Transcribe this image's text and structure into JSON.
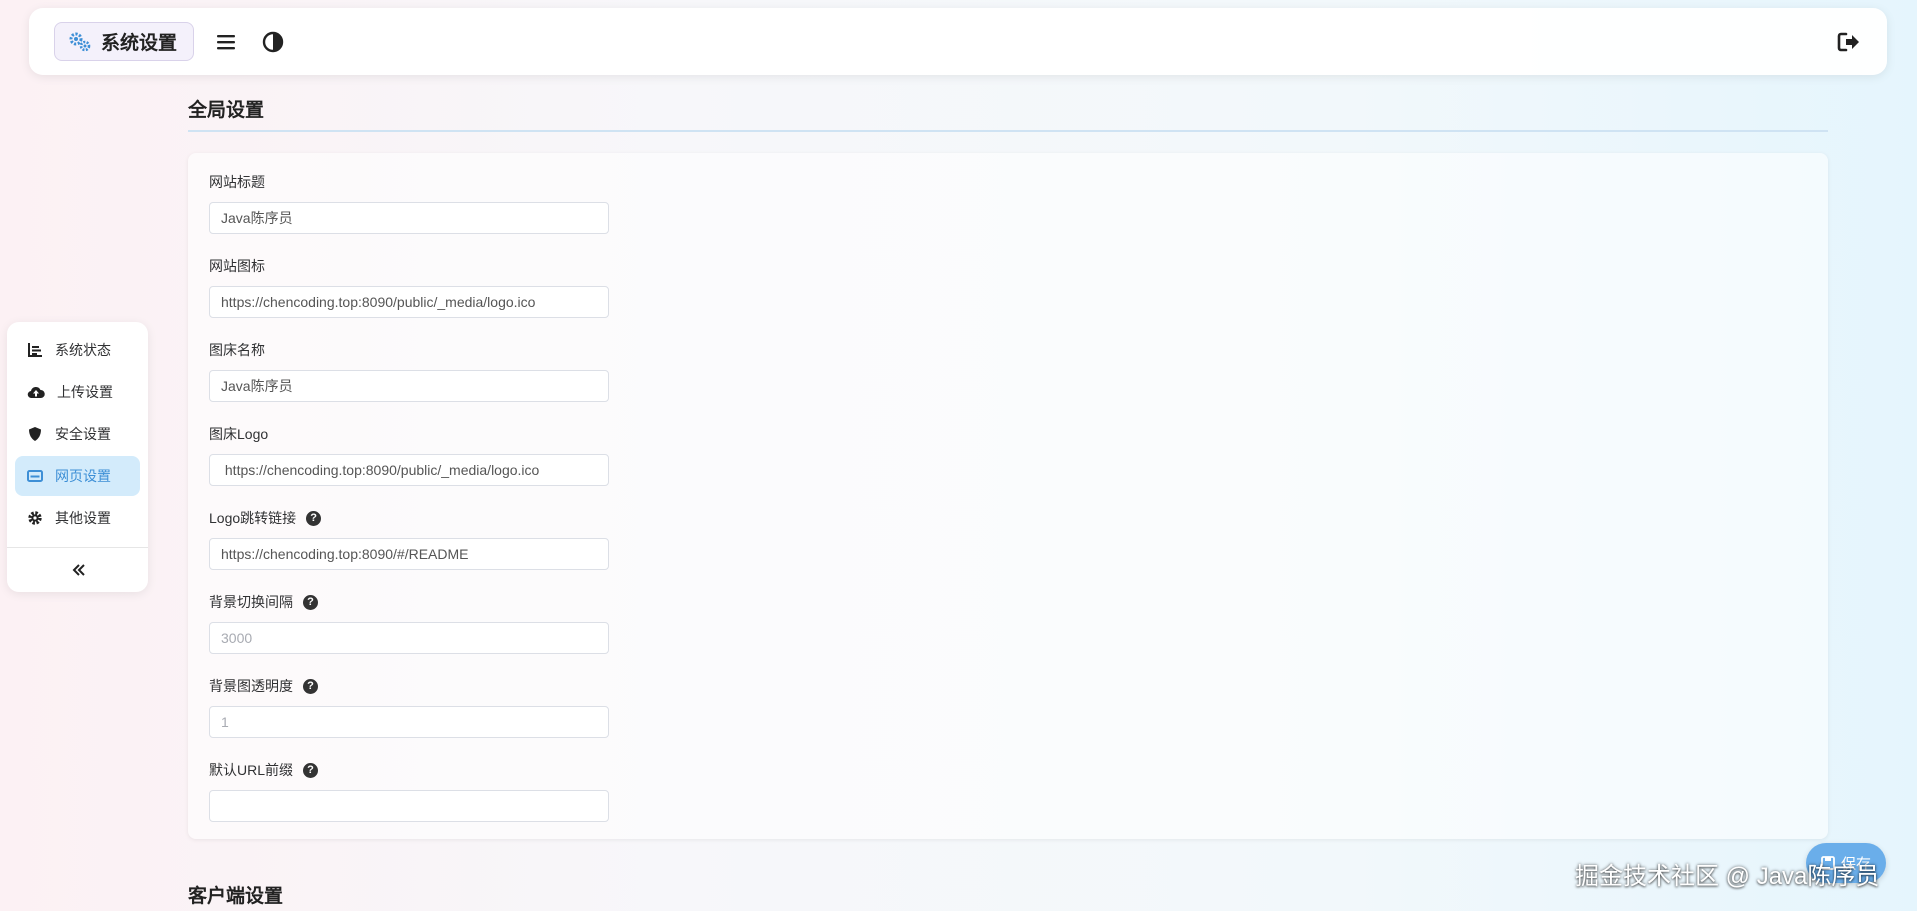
{
  "header": {
    "brand_title": "系统设置",
    "brand_icon": "gears-icon",
    "menu_icon": "hamburger-icon",
    "theme_icon": "contrast-icon",
    "logout_icon": "logout-icon"
  },
  "sidebar": {
    "items": [
      {
        "label": "系统状态",
        "icon": "chart-icon",
        "active": false
      },
      {
        "label": "上传设置",
        "icon": "cloud-upload-icon",
        "active": false
      },
      {
        "label": "安全设置",
        "icon": "shield-icon",
        "active": false
      },
      {
        "label": "网页设置",
        "icon": "web-card-icon",
        "active": true
      },
      {
        "label": "其他设置",
        "icon": "gear-icon",
        "active": false
      }
    ],
    "collapse_icon": "double-chevron-left-icon"
  },
  "global_section": {
    "title": "全局设置",
    "fields": [
      {
        "label": "网站标题",
        "value": "Java陈序员",
        "placeholder": "",
        "help": false
      },
      {
        "label": "网站图标",
        "value": "https://chencoding.top:8090/public/_media/logo.ico",
        "placeholder": "",
        "help": false
      },
      {
        "label": "图床名称",
        "value": "Java陈序员",
        "placeholder": "",
        "help": false
      },
      {
        "label": "图床Logo",
        "value": " https://chencoding.top:8090/public/_media/logo.ico",
        "placeholder": "",
        "help": false
      },
      {
        "label": "Logo跳转链接",
        "value": "https://chencoding.top:8090/#/README",
        "placeholder": "",
        "help": true
      },
      {
        "label": "背景切换间隔",
        "value": "",
        "placeholder": "3000",
        "help": true
      },
      {
        "label": "背景图透明度",
        "value": "",
        "placeholder": "1",
        "help": true
      },
      {
        "label": "默认URL前缀",
        "value": "",
        "placeholder": "",
        "help": true
      }
    ]
  },
  "client_section": {
    "title": "客户端设置"
  },
  "float_button": {
    "label": "保存",
    "icon": "save-icon"
  },
  "watermark": "掘金技术社区 @ Java陈序员",
  "colors": {
    "accent": "#3d8fd6",
    "active_bg": "#d3ebfb",
    "float_button": "#6aaeea"
  }
}
